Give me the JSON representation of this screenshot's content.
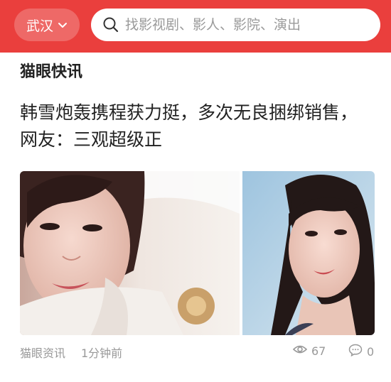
{
  "header": {
    "city": "武汉",
    "search_placeholder": "找影视剧、影人、影院、演出"
  },
  "section": {
    "title": "猫眼快讯"
  },
  "article": {
    "headline": "韩雪炮轰携程获力挺，多次无良捆绑销售，网友：三观超级正",
    "source": "猫眼资讯",
    "time": "1分钟前",
    "views": "67",
    "comments": "0"
  },
  "colors": {
    "brand_red": "#ea3f3d",
    "meta_gray": "#999999"
  },
  "icons": [
    "chevron-down-icon",
    "search-icon",
    "eye-icon",
    "comment-icon"
  ]
}
